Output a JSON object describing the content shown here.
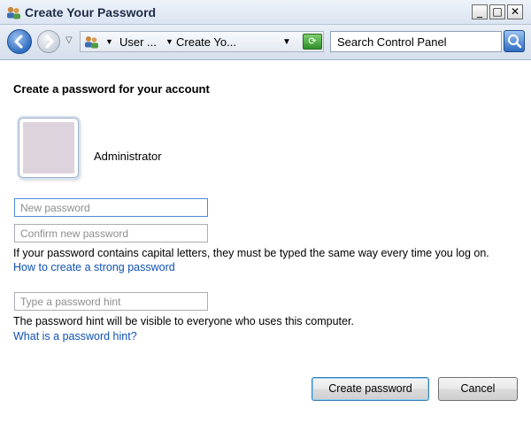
{
  "window": {
    "title": "Create Your Password",
    "controls": {
      "minimize": "_",
      "maximize": "□",
      "close": "✕"
    }
  },
  "nav": {
    "breadcrumbs": [
      "User ...",
      "Create Yo..."
    ],
    "search_placeholder": "Search Control Panel"
  },
  "page": {
    "heading": "Create a password for your account",
    "user_name": "Administrator",
    "fields": {
      "new_password_placeholder": "New password",
      "confirm_password_placeholder": "Confirm new password",
      "hint_placeholder": "Type a password hint"
    },
    "caps_note": "If your password contains capital letters, they must be typed the same way every time you log on.",
    "strong_password_link": "How to create a strong password",
    "hint_note": "The password hint will be visible to everyone who uses this computer.",
    "hint_link": "What is a password hint?"
  },
  "buttons": {
    "create": "Create password",
    "cancel": "Cancel"
  },
  "icons": {
    "title": "users-icon",
    "back": "back-arrow-icon",
    "forward": "forward-arrow-icon",
    "address": "users-icon",
    "refresh": "refresh-icon",
    "search": "search-icon"
  },
  "colors": {
    "link": "#0f51b4",
    "accent": "#2f6cc0"
  }
}
